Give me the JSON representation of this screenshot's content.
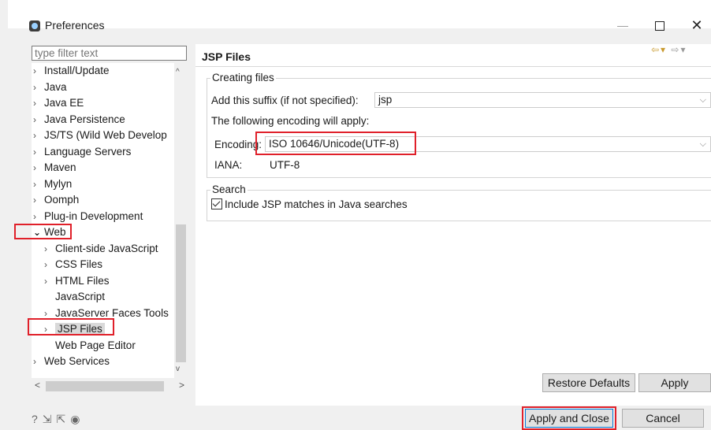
{
  "window": {
    "title": "Preferences"
  },
  "filter": {
    "placeholder": "type filter text"
  },
  "tree": {
    "items": [
      {
        "label": "Install/Update",
        "chev": ">"
      },
      {
        "label": "Java",
        "chev": ">"
      },
      {
        "label": "Java EE",
        "chev": ">"
      },
      {
        "label": "Java Persistence",
        "chev": ">"
      },
      {
        "label": "JS/TS (Wild Web Develop",
        "chev": ">"
      },
      {
        "label": "Language Servers",
        "chev": ">"
      },
      {
        "label": "Maven",
        "chev": ">"
      },
      {
        "label": "Mylyn",
        "chev": ">"
      },
      {
        "label": "Oomph",
        "chev": ">"
      },
      {
        "label": "Plug-in Development",
        "chev": ">"
      },
      {
        "label": "Web",
        "chev": "v"
      },
      {
        "label": "Client-side JavaScript",
        "chev": ">"
      },
      {
        "label": "CSS Files",
        "chev": ">"
      },
      {
        "label": "HTML Files",
        "chev": ">"
      },
      {
        "label": "JavaScript",
        "chev": ""
      },
      {
        "label": "JavaServer Faces Tools",
        "chev": ">"
      },
      {
        "label": "JSP Files",
        "chev": ">"
      },
      {
        "label": "Web Page Editor",
        "chev": ""
      },
      {
        "label": "Web Services",
        "chev": ">"
      }
    ]
  },
  "panel": {
    "title": "JSP Files",
    "creating_group": "Creating files",
    "suffix_label": "Add this suffix (if not specified):",
    "suffix_value": "jsp",
    "encoding_note": "The following encoding will apply:",
    "encoding_label": "Encoding:",
    "encoding_value": "ISO 10646/Unicode(UTF-8)",
    "iana_label": "IANA:",
    "iana_value": "UTF-8",
    "search_group": "Search",
    "include_label": "Include JSP matches in Java searches",
    "include_checked": true
  },
  "buttons": {
    "restore_defaults": "Restore Defaults",
    "apply": "Apply",
    "apply_close": "Apply and Close",
    "cancel": "Cancel"
  },
  "colors": {
    "highlight": "#e0202a",
    "selection": "#d9d9d9"
  }
}
